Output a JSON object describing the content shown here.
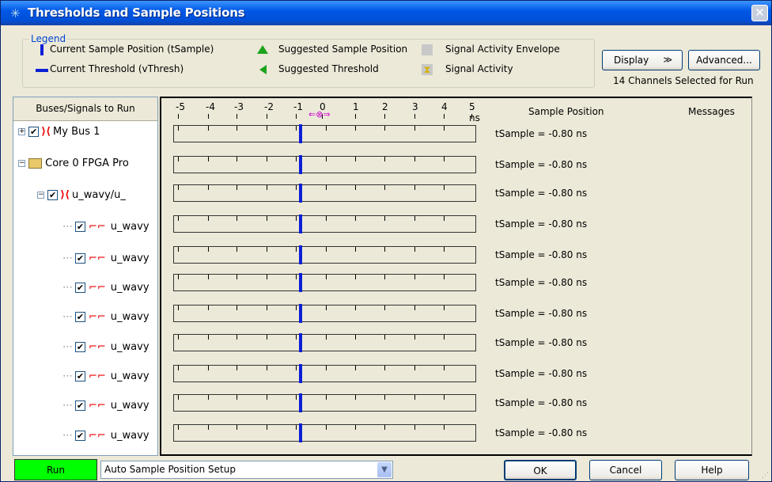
{
  "window": {
    "title": "Thresholds and Sample Positions",
    "close_label": "✕"
  },
  "legend": {
    "title": "Legend",
    "items": [
      {
        "label": "Current Sample Position (tSample)"
      },
      {
        "label": "Current Threshold (vThresh)"
      },
      {
        "label": "Suggested Sample Position"
      },
      {
        "label": "Suggested Threshold"
      },
      {
        "label": "Signal Activity Envelope"
      },
      {
        "label": "Signal Activity"
      }
    ]
  },
  "toolbar": {
    "display_label": "Display",
    "display_arrow": "≫",
    "advanced_label": "Advanced...",
    "channels_selected": "14 Channels Selected for Run"
  },
  "left_panel": {
    "header": "Buses/Signals to Run",
    "tree": [
      {
        "label": "My Bus 1",
        "expander": "+"
      },
      {
        "label": "Core 0 FPGA Pro",
        "expander": "−"
      },
      {
        "label": "u_wavy/u_",
        "expander": "−"
      },
      {
        "label": "u_wavy"
      },
      {
        "label": "u_wavy"
      },
      {
        "label": "u_wavy"
      },
      {
        "label": "u_wavy"
      },
      {
        "label": "u_wavy"
      },
      {
        "label": "u_wavy"
      },
      {
        "label": "u_wavy"
      },
      {
        "label": "u_wavy"
      }
    ]
  },
  "right_panel": {
    "scale_ticks": [
      "-5",
      "-4",
      "-3",
      "-2",
      "-1",
      "0",
      "1",
      "2",
      "3",
      "4",
      "5 ns"
    ],
    "sample_position_header": "Sample Position",
    "messages_header": "Messages",
    "rows": [
      {
        "tsample": "tSample = -0.80 ns"
      },
      {
        "tsample": "tSample = -0.80 ns"
      },
      {
        "tsample": "tSample = -0.80 ns"
      },
      {
        "tsample": "tSample = -0.80 ns"
      },
      {
        "tsample": "tSample = -0.80 ns"
      },
      {
        "tsample": "tSample = -0.80 ns"
      },
      {
        "tsample": "tSample = -0.80 ns"
      },
      {
        "tsample": "tSample = -0.80 ns"
      },
      {
        "tsample": "tSample = -0.80 ns"
      },
      {
        "tsample": "tSample = -0.80 ns"
      },
      {
        "tsample": "tSample = -0.80 ns"
      }
    ]
  },
  "bottom": {
    "run_label": "Run",
    "mode_value": "Auto Sample Position Setup",
    "ok_label": "OK",
    "cancel_label": "Cancel",
    "help_label": "Help"
  },
  "colors": {
    "sample_marker": "#0b1fd6",
    "run_button": "#00ff00",
    "titlebar": "#0058e6"
  }
}
